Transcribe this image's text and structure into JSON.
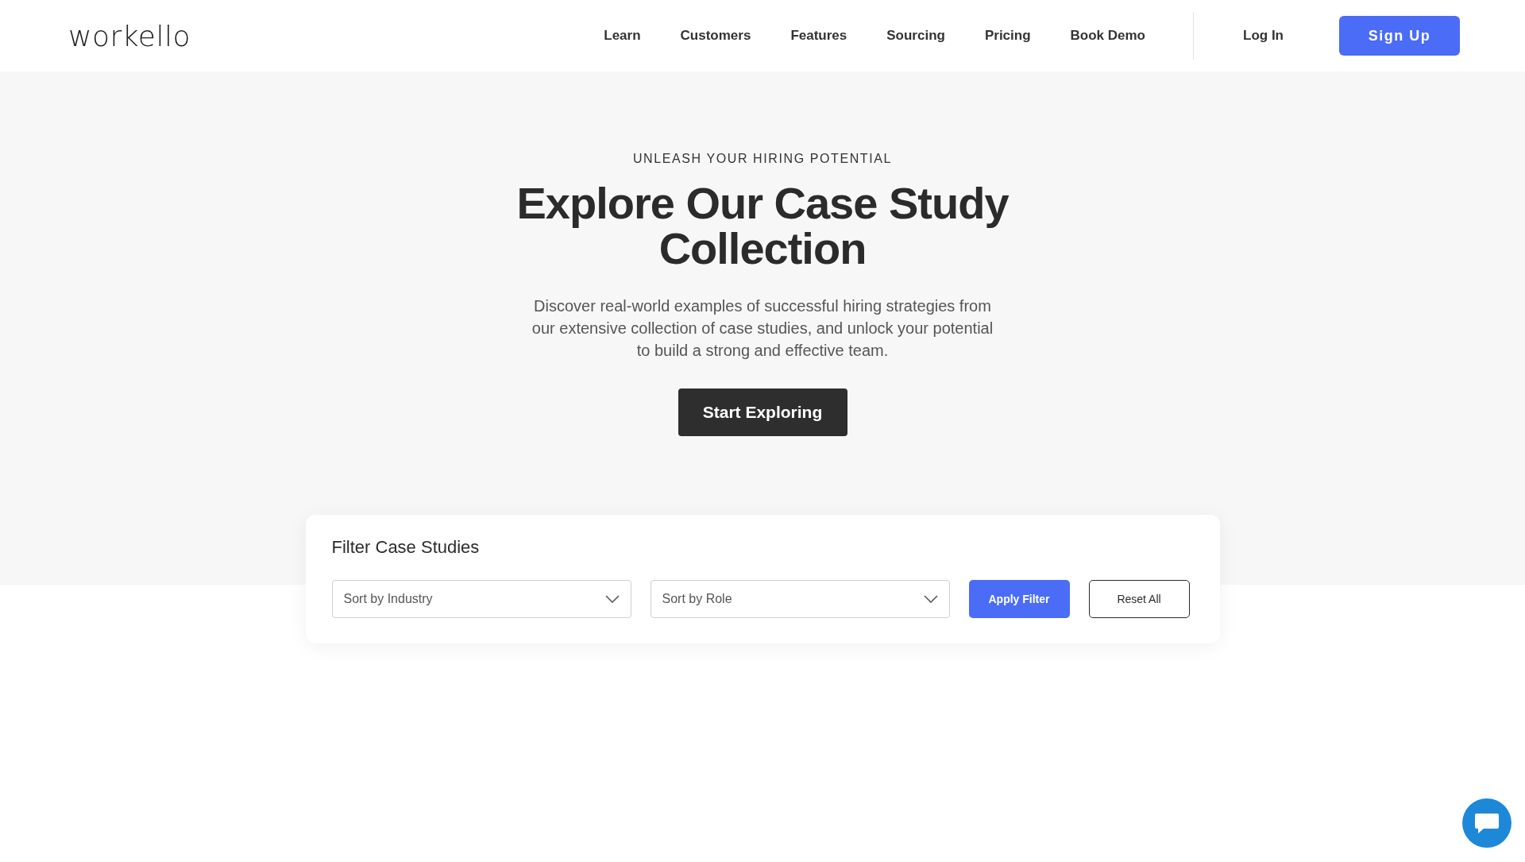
{
  "header": {
    "logo": "workello",
    "nav": [
      {
        "label": "Learn"
      },
      {
        "label": "Customers"
      },
      {
        "label": "Features"
      },
      {
        "label": "Sourcing"
      },
      {
        "label": "Pricing"
      },
      {
        "label": "Book Demo"
      }
    ],
    "login": "Log In",
    "signup": "Sign Up"
  },
  "hero": {
    "eyebrow": "UNLEASH YOUR HIRING POTENTIAL",
    "title": "Explore Our Case Study Collection",
    "description": "Discover real-world examples of successful hiring strategies from our extensive collection of case studies, and unlock your potential to build a strong and effective team.",
    "cta": "Start Exploring"
  },
  "filter": {
    "title": "Filter Case Studies",
    "selects": [
      {
        "placeholder": "Sort by Industry"
      },
      {
        "placeholder": "Sort by Role"
      }
    ],
    "apply": "Apply Filter",
    "reset": "Reset All"
  }
}
